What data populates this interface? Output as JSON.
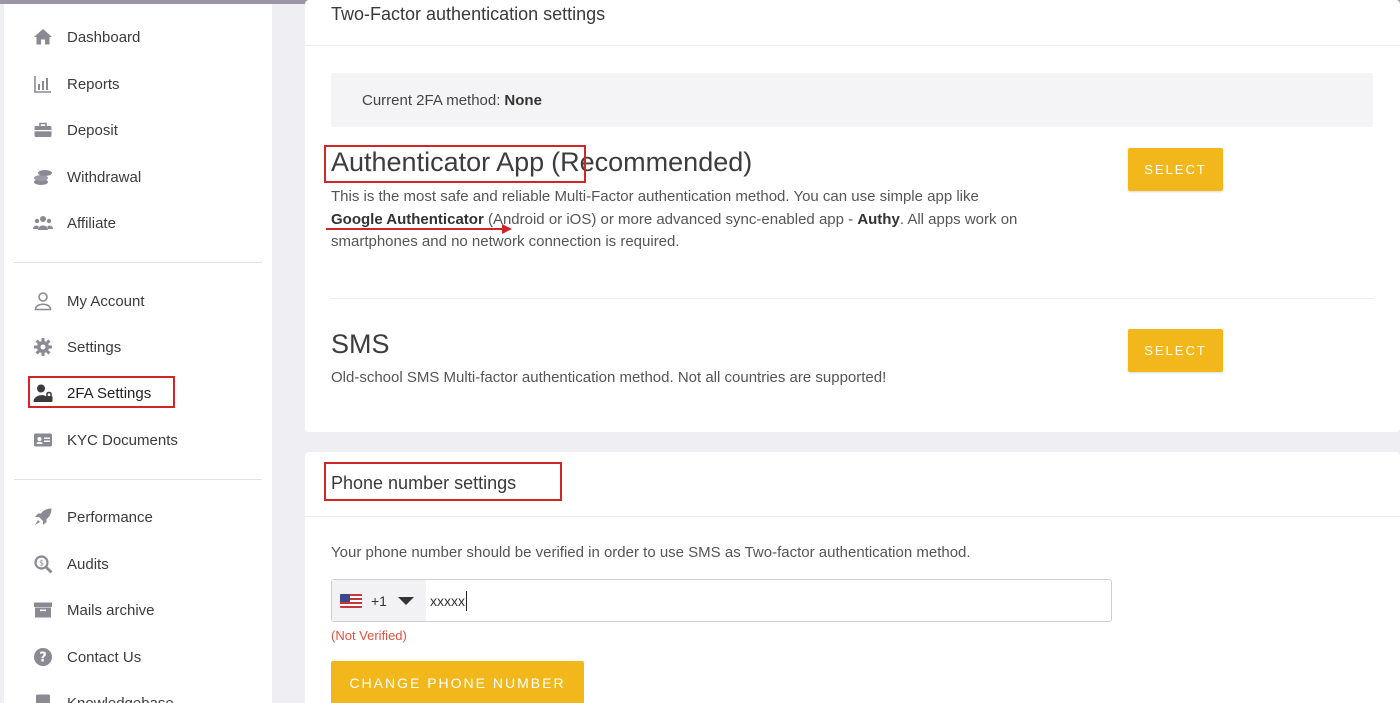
{
  "sidebar": {
    "items": [
      {
        "label": "Dashboard",
        "icon": "home-icon"
      },
      {
        "label": "Reports",
        "icon": "reports-icon"
      },
      {
        "label": "Deposit",
        "icon": "briefcase-icon"
      },
      {
        "label": "Withdrawal",
        "icon": "coins-icon"
      },
      {
        "label": "Affiliate",
        "icon": "users-icon"
      },
      {
        "label": "My Account",
        "icon": "user-icon"
      },
      {
        "label": "Settings",
        "icon": "gear-icon"
      },
      {
        "label": "2FA Settings",
        "icon": "user-lock-icon",
        "active": true
      },
      {
        "label": "KYC Documents",
        "icon": "id-card-icon"
      },
      {
        "label": "Performance",
        "icon": "rocket-icon"
      },
      {
        "label": "Audits",
        "icon": "magnifier-icon"
      },
      {
        "label": "Mails archive",
        "icon": "archive-icon"
      },
      {
        "label": "Contact Us",
        "icon": "question-icon"
      },
      {
        "label": "Knowledgebase",
        "icon": "book-icon"
      }
    ]
  },
  "twofa": {
    "title": "Two-Factor authentication settings",
    "current_label": "Current 2FA method:",
    "current_value": "None",
    "app": {
      "title": "Authenticator App",
      "suffix": "(Recommended)",
      "desc_1": "This is the most safe and reliable Multi-Factor authentication method. You can use simple app like",
      "desc_bold_1": "Google Authenticator",
      "desc_2": " (Android or iOS) or more advanced sync-enabled app - ",
      "desc_bold_2": "Authy",
      "desc_3": ". All apps work on smartphones and no network connection is required.",
      "button": "SELECT"
    },
    "sms": {
      "title": "SMS",
      "desc": "Old-school SMS Multi-factor authentication method. Not all countries are supported!",
      "button": "SELECT"
    }
  },
  "phone": {
    "title": "Phone number settings",
    "desc": "Your phone number should be verified in order to use SMS as Two-factor authentication method.",
    "country_code": "+1",
    "value": "xxxxx",
    "status": "(Not Verified)",
    "button": "CHANGE PHONE NUMBER"
  },
  "colors": {
    "accent": "#f2b81b",
    "annotation": "#d0262a",
    "error": "#e0533f"
  }
}
